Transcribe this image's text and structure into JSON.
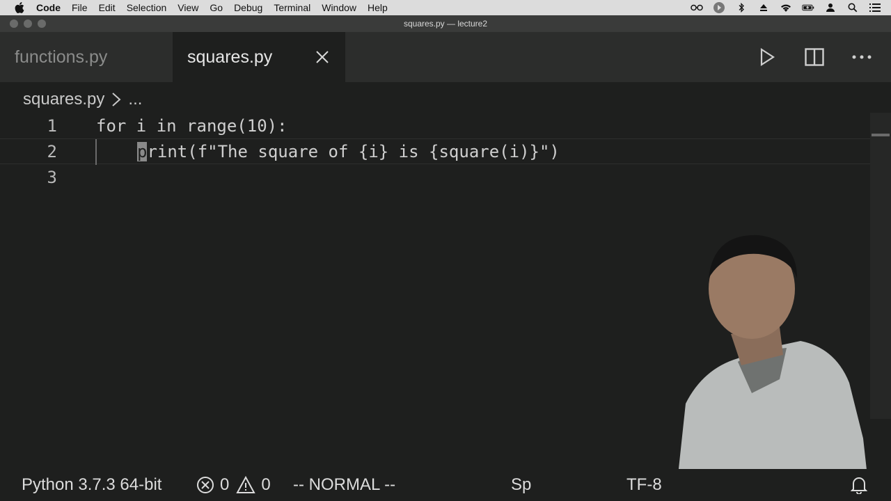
{
  "menubar": {
    "app_name": "Code",
    "items": [
      "File",
      "Edit",
      "Selection",
      "View",
      "Go",
      "Debug",
      "Terminal",
      "Window",
      "Help"
    ]
  },
  "window": {
    "title": "squares.py — lecture2"
  },
  "tabs": [
    {
      "label": "functions.py",
      "active": false
    },
    {
      "label": "squares.py",
      "active": true
    }
  ],
  "breadcrumb": {
    "file": "squares.py",
    "more": "..."
  },
  "editor": {
    "lines": [
      {
        "number": "1",
        "code": "for i in range(10):"
      },
      {
        "number": "2",
        "code_cursor_char": "p",
        "code": "rint(f\"The square of {i} is {square(i)}\")"
      },
      {
        "number": "3",
        "code": ""
      }
    ]
  },
  "statusbar": {
    "interpreter": "Python 3.7.3 64-bit",
    "errors": "0",
    "warnings": "0",
    "mode": "-- NORMAL --",
    "spaces": "Sp",
    "encoding": "TF-8"
  },
  "colors": {
    "editor_bg": "#1e1f1e",
    "tabbar_bg": "#2c2d2c",
    "menubar_bg": "#dcdcdc"
  }
}
